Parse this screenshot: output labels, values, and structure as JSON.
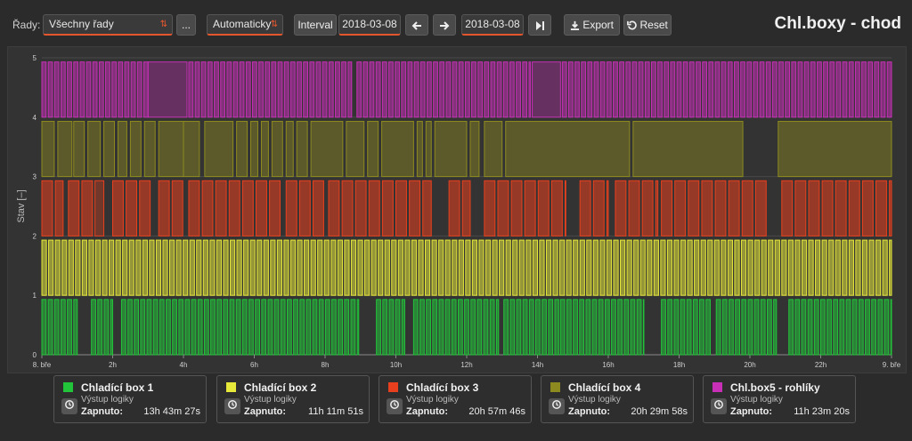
{
  "toolbar": {
    "series_label": "Řady:",
    "series_select": "Všechny řady",
    "more_label": "...",
    "mode_select": "Automaticky",
    "interval_label": "Interval",
    "date_from": "2018-03-08",
    "date_to": "2018-03-08",
    "export_label": "Export",
    "reset_label": "Reset",
    "title": "Chl.boxy - chod"
  },
  "colors": {
    "accent": "#e4572e",
    "background": "#2b2b2b",
    "plot": "#333333"
  },
  "chart_data": {
    "type": "area",
    "ylabel": "Stav [–]",
    "ylim": [
      0,
      5
    ],
    "yticks": [
      "0",
      "1",
      "2",
      "3",
      "4",
      "5"
    ],
    "xticks": [
      "8. bře",
      "2h",
      "4h",
      "6h",
      "8h",
      "10h",
      "12h",
      "14h",
      "16h",
      "18h",
      "20h",
      "22h",
      "9. bře"
    ],
    "x_unit": "hours since 2018-03-08 00:00",
    "xlim": [
      0,
      24
    ],
    "series": [
      {
        "name": "Chladící box 1",
        "base": 0,
        "height": 0.93,
        "color": "#22c43a",
        "blocks": [
          [
            0,
            1.0
          ],
          [
            1.4,
            2.0
          ],
          [
            2.25,
            8.95
          ],
          [
            9.45,
            10.25
          ],
          [
            10.5,
            12.9
          ],
          [
            13.05,
            14.6
          ],
          [
            14.65,
            17.0
          ],
          [
            17.5,
            18.9
          ],
          [
            19.05,
            20.75
          ],
          [
            21.1,
            24
          ]
        ],
        "offs": [
          [
            1.0,
            1.4
          ],
          [
            8.95,
            9.45
          ],
          [
            17.0,
            17.5
          ]
        ],
        "pulse_on": 0.12,
        "pulse_off": 0.06
      },
      {
        "name": "Chladící box 2",
        "base": 1,
        "height": 0.93,
        "color": "#e6e83a",
        "blocks": [
          [
            0,
            24
          ]
        ],
        "offs": [],
        "pulse_on": 0.13,
        "pulse_off": 0.06
      },
      {
        "name": "Chladící box 3",
        "base": 2,
        "height": 0.93,
        "color": "#e8401e",
        "blocks": [
          [
            0,
            0.6
          ],
          [
            0.75,
            1.5
          ],
          [
            1.5,
            1.75
          ],
          [
            2.0,
            3.1
          ],
          [
            3.3,
            4.0
          ],
          [
            4.15,
            6.8
          ],
          [
            6.9,
            8.0
          ],
          [
            8.1,
            11.0
          ],
          [
            11.5,
            12.1
          ],
          [
            12.5,
            14.8
          ],
          [
            15.2,
            16.0
          ],
          [
            16.2,
            17.4
          ],
          [
            17.5,
            20.5
          ],
          [
            20.9,
            24
          ]
        ],
        "offs": [
          [
            1.5,
            1.75
          ]
        ],
        "pulse_on": 0.3,
        "pulse_off": 0.08
      },
      {
        "name": "Chladící box 4",
        "base": 3,
        "height": 0.93,
        "color": "#8d8a1f",
        "blocks": [
          [
            0,
            0.35
          ],
          [
            0.45,
            0.85
          ],
          [
            0.9,
            1.2
          ],
          [
            1.3,
            1.65
          ],
          [
            1.75,
            2.05
          ],
          [
            2.15,
            2.4
          ],
          [
            2.5,
            2.8
          ],
          [
            2.9,
            3.2
          ],
          [
            3.3,
            4.0
          ],
          [
            4.0,
            4.45
          ],
          [
            4.6,
            5.4
          ],
          [
            5.5,
            5.8
          ],
          [
            5.9,
            6.1
          ],
          [
            6.2,
            6.4
          ],
          [
            6.5,
            6.8
          ],
          [
            6.9,
            7.1
          ],
          [
            7.2,
            7.5
          ],
          [
            7.6,
            8.5
          ],
          [
            8.6,
            9.1
          ],
          [
            9.2,
            9.5
          ],
          [
            9.6,
            10.5
          ],
          [
            10.6,
            10.75
          ],
          [
            10.85,
            11.0
          ],
          [
            11.1,
            12.0
          ],
          [
            12.1,
            12.35
          ],
          [
            12.5,
            13.0
          ],
          [
            13.1,
            16.6
          ],
          [
            16.7,
            19.8
          ],
          [
            20.8,
            24
          ]
        ],
        "offs": [],
        "pulse_on": 0,
        "pulse_off": 0
      },
      {
        "name": "Chl.box5 - rohlíky",
        "base": 4,
        "height": 0.93,
        "color": "#c62fb6",
        "blocks": [
          [
            0,
            3.0
          ],
          [
            3.0,
            4.1
          ],
          [
            4.15,
            8.75
          ],
          [
            8.9,
            13.8
          ],
          [
            13.85,
            14.65
          ],
          [
            14.7,
            24
          ]
        ],
        "offs": [
          [
            3.0,
            4.1
          ],
          [
            13.85,
            14.65
          ]
        ],
        "pulse_on": 0.12,
        "pulse_off": 0.06
      }
    ]
  },
  "legend": [
    {
      "name": "Chladící box 1",
      "sub": "Výstup logiky",
      "key": "Zapnuto:",
      "value": "13h 43m 27s",
      "color": "#22c43a"
    },
    {
      "name": "Chladící box 2",
      "sub": "Výstup logiky",
      "key": "Zapnuto:",
      "value": "11h 11m 51s",
      "color": "#e6e83a"
    },
    {
      "name": "Chladící box 3",
      "sub": "Výstup logiky",
      "key": "Zapnuto:",
      "value": "20h 57m 46s",
      "color": "#e8401e"
    },
    {
      "name": "Chladící box 4",
      "sub": "Výstup logiky",
      "key": "Zapnuto:",
      "value": "20h 29m 58s",
      "color": "#8d8a1f"
    },
    {
      "name": "Chl.box5 - rohlíky",
      "sub": "Výstup logiky",
      "key": "Zapnuto:",
      "value": "11h 23m 20s",
      "color": "#c62fb6"
    }
  ]
}
